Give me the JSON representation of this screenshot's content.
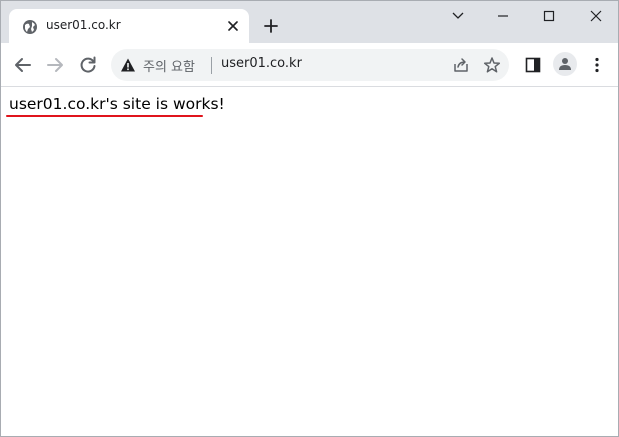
{
  "browser": {
    "tab": {
      "title": "user01.co.kr",
      "favicon": "globe-icon"
    },
    "window_controls": [
      "chevron-down-icon",
      "minimize-icon",
      "maximize-icon",
      "close-icon"
    ]
  },
  "toolbar": {
    "security_label": "주의 요함",
    "url": "user01.co.kr"
  },
  "page": {
    "text": "user01.co.kr's site is works!",
    "annotation_color": "#e0141c"
  }
}
